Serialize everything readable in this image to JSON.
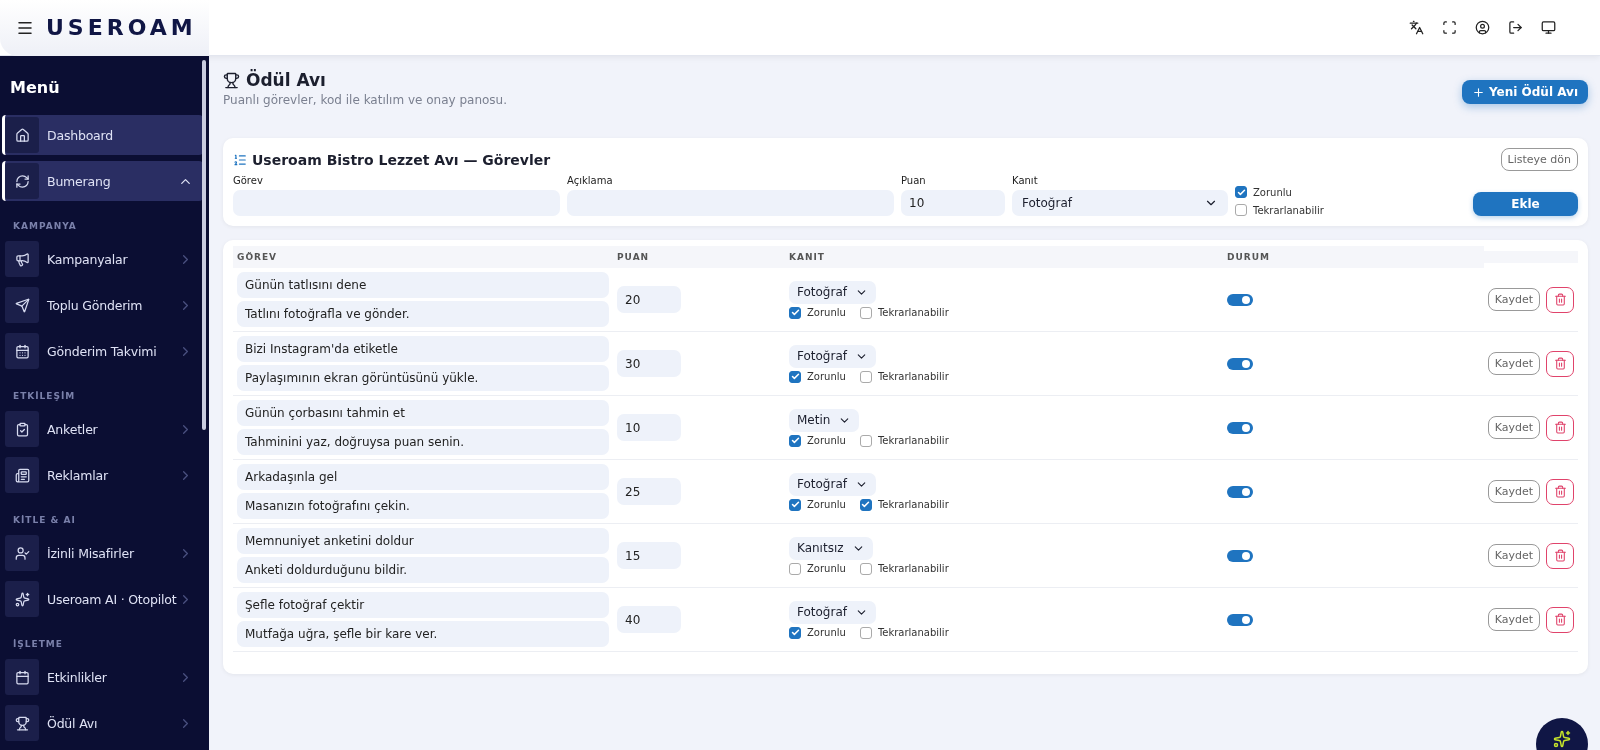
{
  "topbar": {
    "logo": "USEROAM"
  },
  "sidebar": {
    "title": "Menü",
    "groups": [
      {
        "items": [
          {
            "label": "Dashboard",
            "selected": true
          },
          {
            "label": "Bumerang",
            "selected": true,
            "expanded": true
          }
        ]
      },
      {
        "heading": "KAMPANYA",
        "items": [
          {
            "label": "Kampanyalar",
            "selected": false,
            "expanded": false
          },
          {
            "label": "Toplu Gönderim",
            "selected": false,
            "expanded": false
          },
          {
            "label": "Gönderim Takvimi",
            "selected": false,
            "expanded": false
          }
        ]
      },
      {
        "heading": "ETKİLEŞİM",
        "items": [
          {
            "label": "Anketler",
            "selected": false,
            "expanded": false
          },
          {
            "label": "Reklamlar",
            "selected": false,
            "expanded": false
          }
        ]
      },
      {
        "heading": "KİTLE & AI",
        "items": [
          {
            "label": "İzinli Misafirler",
            "selected": false,
            "expanded": false
          },
          {
            "label": "Useroam AI · Otopilot",
            "selected": false,
            "expanded": false
          }
        ]
      },
      {
        "heading": "İŞLETME",
        "items": [
          {
            "label": "Etkinlikler",
            "selected": false,
            "expanded": false
          },
          {
            "label": "Ödül Avı",
            "selected": false,
            "expanded": false
          }
        ]
      }
    ]
  },
  "page": {
    "title": "Ödül Avı",
    "subtitle": "Puanlı görevler, kod ile katılım ve onay panosu.",
    "new_button": "Yeni Ödül Avı"
  },
  "form": {
    "title": "Useroam Bistro Lezzet Avı — Görevler",
    "back_button": "Listeye dön",
    "fields": [
      {
        "label": "Görev"
      },
      {
        "label": "Açıklama"
      },
      {
        "label": "Puan",
        "value": "10"
      }
    ],
    "evidence": {
      "label": "Kanıt",
      "value": "Fotoğraf"
    },
    "required": {
      "label": "Zorunlu",
      "checked": true
    },
    "repeatable": {
      "label": "Tekrarlanabilir",
      "checked": false
    },
    "add_button": "Ekle"
  },
  "table": {
    "columns": [
      "GÖREV",
      "PUAN",
      "KANIT",
      "DURUM"
    ],
    "rows": [
      {
        "title": "Günün tatlısını dene",
        "description": "Tatlını fotoğrafla ve gönder.",
        "points": "20",
        "evidence": "Fotoğraf",
        "required_label": "Zorunlu",
        "required": true,
        "repeatable_label": "Tekrarlanabilir",
        "repeatable": false,
        "active": true,
        "save": "Kaydet"
      },
      {
        "title": "Bizi Instagram'da etiketle",
        "description": "Paylaşımının ekran görüntüsünü yükle.",
        "points": "30",
        "evidence": "Fotoğraf",
        "required_label": "Zorunlu",
        "required": true,
        "repeatable_label": "Tekrarlanabilir",
        "repeatable": false,
        "active": true,
        "save": "Kaydet"
      },
      {
        "title": "Günün çorbasını tahmin et",
        "description": "Tahminini yaz, doğruysa puan senin.",
        "points": "10",
        "evidence": "Metin",
        "required_label": "Zorunlu",
        "required": true,
        "repeatable_label": "Tekrarlanabilir",
        "repeatable": false,
        "active": true,
        "save": "Kaydet"
      },
      {
        "title": "Arkadaşınla gel",
        "description": "Masanızın fotoğrafını çekin.",
        "points": "25",
        "evidence": "Fotoğraf",
        "required_label": "Zorunlu",
        "required": true,
        "repeatable_label": "Tekrarlanabilir",
        "repeatable": true,
        "active": true,
        "save": "Kaydet"
      },
      {
        "title": "Memnuniyet anketini doldur",
        "description": "Anketi doldurduğunu bildir.",
        "points": "15",
        "evidence": "Kanıtsız",
        "required_label": "Zorunlu",
        "required": false,
        "repeatable_label": "Tekrarlanabilir",
        "repeatable": false,
        "active": true,
        "save": "Kaydet"
      },
      {
        "title": "Şefle fotoğraf çektir",
        "description": "Mutfağa uğra, şefle bir kare ver.",
        "points": "40",
        "evidence": "Fotoğraf",
        "required_label": "Zorunlu",
        "required": true,
        "repeatable_label": "Tekrarlanabilir",
        "repeatable": false,
        "active": true,
        "save": "Kaydet"
      }
    ]
  }
}
